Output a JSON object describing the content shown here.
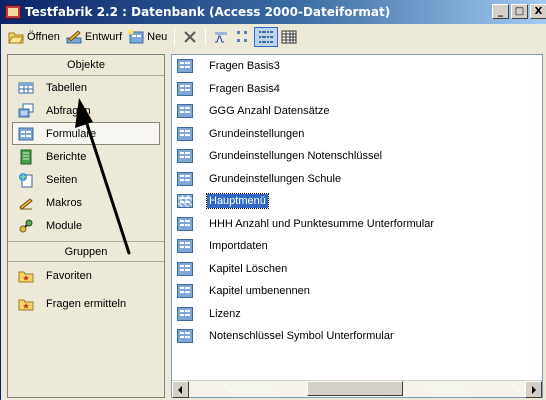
{
  "window": {
    "title": "Testfabrik 2.2 : Datenbank (Access 2000-Dateiformat)",
    "minimize": "_",
    "maximize": "□",
    "close": "X"
  },
  "toolbar": {
    "open_label": "Öffnen",
    "design_label": "Entwurf",
    "new_label": "Neu",
    "delete_symbol": "X"
  },
  "sidebar": {
    "objects_header": "Objekte",
    "objects": [
      {
        "label": "Tabellen",
        "icon": "table-icon"
      },
      {
        "label": "Abfragen",
        "icon": "query-icon"
      },
      {
        "label": "Formulare",
        "icon": "form-icon"
      },
      {
        "label": "Berichte",
        "icon": "report-icon"
      },
      {
        "label": "Seiten",
        "icon": "page-icon"
      },
      {
        "label": "Makros",
        "icon": "macro-icon"
      },
      {
        "label": "Module",
        "icon": "module-icon"
      }
    ],
    "groups_header": "Gruppen",
    "groups": [
      {
        "label": "Favoriten",
        "icon": "favorites-folder-icon"
      },
      {
        "label": "Fragen ermitteln",
        "icon": "group-folder-icon"
      }
    ]
  },
  "list": {
    "items": [
      "Fragen Basis3",
      "Fragen Basis4",
      "GGG Anzahl Datensätze",
      "Grundeinstellungen",
      "Grundeinstellungen Notenschlüssel",
      "Grundeinstellungen Schule",
      "Hauptmenü",
      "HHH Anzahl und Punktesumme Unterformular",
      "Importdaten",
      "Kapitel Löschen",
      "Kapitel umbenennen",
      "Lizenz",
      "Notenschlüssel Symbol Unterformular"
    ],
    "selected_index": 6
  },
  "colors": {
    "titlebar_start": "#0a246a",
    "titlebar_end": "#a6caf0",
    "selection": "#316ac5",
    "arrow": "#000000"
  }
}
